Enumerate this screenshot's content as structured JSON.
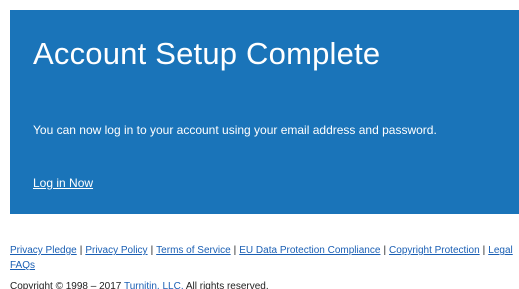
{
  "panel": {
    "title": "Account Setup Complete",
    "message": "You can now log in to your account using your email address and password.",
    "login_link": "Log in Now",
    "background_color": "#1a74b9"
  },
  "footer": {
    "links": [
      "Privacy Pledge",
      "Privacy Policy",
      "Terms of Service",
      "EU Data Protection Compliance",
      "Copyright Protection",
      "Legal FAQs"
    ],
    "separator": "|",
    "copyright_prefix": "Copyright © 1998 – 2017",
    "company_link": "Turnitin, LLC.",
    "copyright_suffix": "All rights reserved.",
    "link_color": "#1a5fb4"
  }
}
